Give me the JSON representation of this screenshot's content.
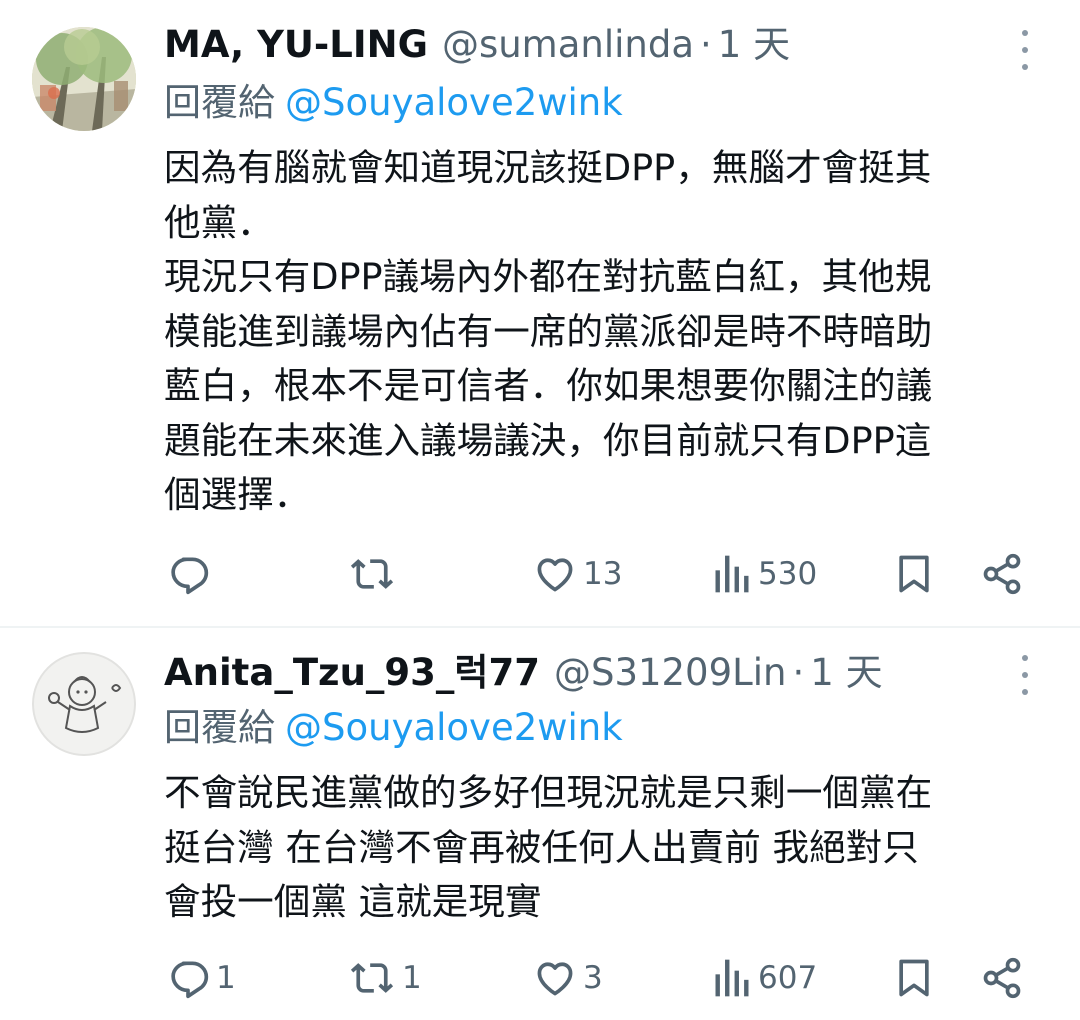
{
  "tweets": [
    {
      "display_name": "MA, YU-LING",
      "handle": "@sumanlinda",
      "separator": "·",
      "time": "1 天",
      "reply_label": "回覆給",
      "reply_handle": "@Souyalove2wink",
      "body_lines": [
        "因為有腦就會知道現況該挺DPP，無腦才會挺其",
        "他黨．",
        "現況只有DPP議場內外都在對抗藍白紅，其他規",
        "模能進到議場內佔有一席的黨派卻是時不時暗助",
        "藍白，根本不是可信者．你如果想要你關注的議",
        "題能在未來進入議場議決，你目前就只有DPP這",
        "個選擇．"
      ],
      "reply_count": "",
      "retweet_count": "",
      "like_count": "13",
      "view_count": "530"
    },
    {
      "display_name": "Anita_Tzu_93_럭77",
      "handle": "@S31209Lin",
      "separator": "·",
      "time": "1 天",
      "reply_label": "回覆給",
      "reply_handle": "@Souyalove2wink",
      "body_lines": [
        "不會說民進黨做的多好但現況就是只剩一個黨在",
        "挺台灣 在台灣不會再被任何人出賣前 我絕對只",
        "會投一個黨 這就是現實"
      ],
      "reply_count": "1",
      "retweet_count": "1",
      "like_count": "3",
      "view_count": "607"
    }
  ],
  "colors": {
    "text": "#0f1419",
    "secondary": "#536471",
    "link": "#1d9bf0",
    "divider": "#eff3f4"
  },
  "icons": [
    "more-vertical-icon",
    "reply-icon",
    "retweet-icon",
    "like-icon",
    "views-icon",
    "bookmark-icon",
    "share-icon"
  ]
}
